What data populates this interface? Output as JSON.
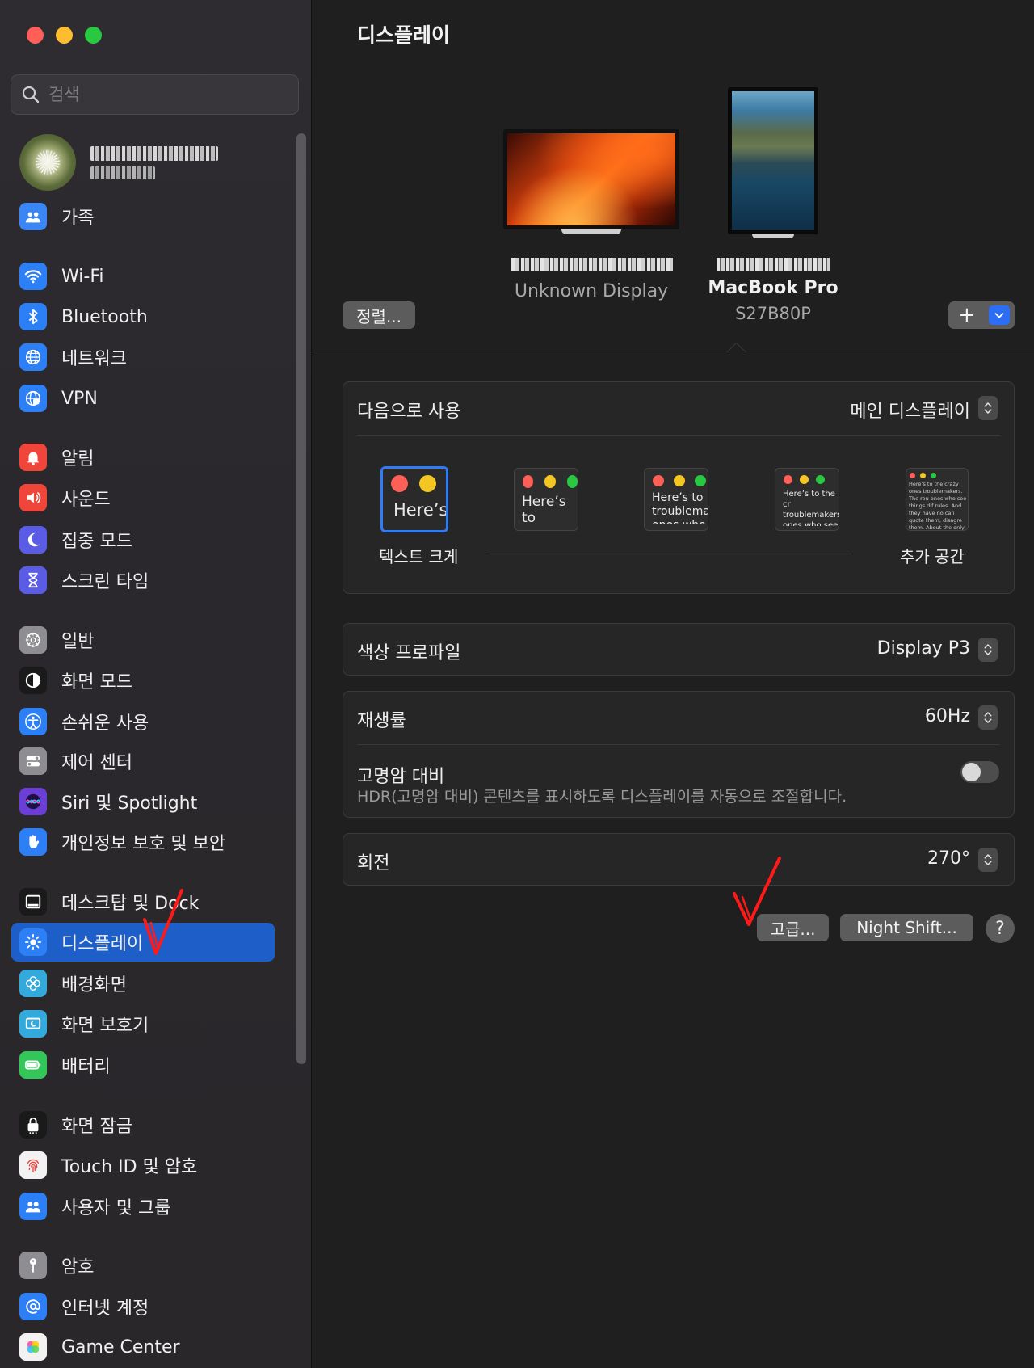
{
  "window": {
    "title": "디스플레이"
  },
  "search": {
    "placeholder": "검색"
  },
  "profile": {
    "name": "redacted-name",
    "sub": "redacted-sub"
  },
  "sidebar": {
    "items": [
      {
        "label": "가족",
        "icon": "family-icon",
        "color": "#3a86f5"
      },
      {
        "label": "Wi-Fi",
        "icon": "wifi-icon",
        "color": "#2d7ff5"
      },
      {
        "label": "Bluetooth",
        "icon": "bluetooth-icon",
        "color": "#2d7ff5"
      },
      {
        "label": "네트워크",
        "icon": "globe-icon",
        "color": "#2d7ff5"
      },
      {
        "label": "VPN",
        "icon": "vpn-globe-icon",
        "color": "#2d7ff5"
      },
      {
        "label": "알림",
        "icon": "bell-icon",
        "color": "#f0453a"
      },
      {
        "label": "사운드",
        "icon": "speaker-icon",
        "color": "#f0453a"
      },
      {
        "label": "집중 모드",
        "icon": "moon-icon",
        "color": "#5b5ce6"
      },
      {
        "label": "스크린 타임",
        "icon": "hourglass-icon",
        "color": "#5b5ce6"
      },
      {
        "label": "일반",
        "icon": "gear-icon",
        "color": "#8e8e92"
      },
      {
        "label": "화면 모드",
        "icon": "appearance-icon",
        "color": "#1a1a1a"
      },
      {
        "label": "손쉬운 사용",
        "icon": "accessibility-icon",
        "color": "#2d7ff5"
      },
      {
        "label": "제어 센터",
        "icon": "toggles-icon",
        "color": "#8e8e92"
      },
      {
        "label": "Siri 및 Spotlight",
        "icon": "siri-icon",
        "color": "#6b3fd6"
      },
      {
        "label": "개인정보 보호 및 보안",
        "icon": "hand-icon",
        "color": "#2d7ff5"
      },
      {
        "label": "데스크탑 및 Dock",
        "icon": "dock-icon",
        "color": "#1a1a1a"
      },
      {
        "label": "디스플레이",
        "icon": "sun-icon",
        "color": "#2d7ff5"
      },
      {
        "label": "배경화면",
        "icon": "flower-icon",
        "color": "#34aadc"
      },
      {
        "label": "화면 보호기",
        "icon": "screensaver-icon",
        "color": "#34aadc"
      },
      {
        "label": "배터리",
        "icon": "battery-icon",
        "color": "#33c759"
      },
      {
        "label": "화면 잠금",
        "icon": "lock-icon",
        "color": "#1a1a1a"
      },
      {
        "label": "Touch ID 및 암호",
        "icon": "fingerprint-icon",
        "color": "#f2f2f2"
      },
      {
        "label": "사용자 및 그룹",
        "icon": "users-icon",
        "color": "#2d7ff5"
      },
      {
        "label": "암호",
        "icon": "key-icon",
        "color": "#8e8e92"
      },
      {
        "label": "인터넷 계정",
        "icon": "at-icon",
        "color": "#2d7ff5"
      },
      {
        "label": "Game Center",
        "icon": "gamecenter-icon",
        "color": "#f2f2f2"
      }
    ],
    "selected_index": 16
  },
  "displays": {
    "external": {
      "name": "redacted-display-name",
      "subtitle": "Unknown Display"
    },
    "macbook": {
      "name": "redacted-name",
      "title": "MacBook Pro",
      "subtitle": "S27B80P"
    },
    "arrange_label": "정렬...",
    "add_label": "+"
  },
  "use_as": {
    "label": "다음으로 사용",
    "value": "메인 디스플레이",
    "options": [
      {
        "sample": "Here’s"
      },
      {
        "sample": "Here’s to troublem"
      },
      {
        "sample": "Here’s to troublema ones who"
      },
      {
        "sample": "Here’s to the cr troublemakers. ones who see t rules. And they"
      },
      {
        "sample": "Here’s to the crazy ones troublemakers. The rou ones who see things dif rules. And they have no can quote them, disagre them. About the only th Because they change th"
      }
    ],
    "left_label": "텍스트 크게",
    "right_label": "추가 공간"
  },
  "color_profile": {
    "label": "색상 프로파일",
    "value": "Display P3"
  },
  "refresh": {
    "label": "재생률",
    "value": "60Hz"
  },
  "hdr": {
    "label": "고명암 대비",
    "description": "HDR(고명암 대비) 콘텐츠를 표시하도록 디스플레이를 자동으로 조절합니다.",
    "enabled": false
  },
  "rotation": {
    "label": "회전",
    "value": "270°"
  },
  "buttons": {
    "advanced": "고급...",
    "night_shift": "Night Shift...",
    "help": "?"
  },
  "colors": {
    "accent": "#2f7cf6",
    "selected_row": "#1d5ec9",
    "annotation": "#ff1a1a"
  }
}
